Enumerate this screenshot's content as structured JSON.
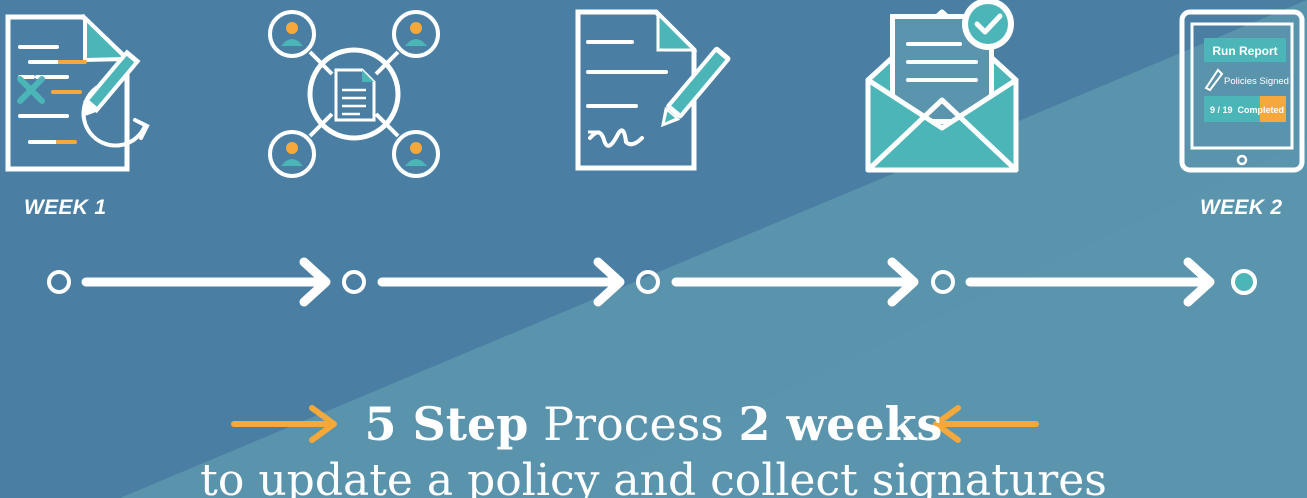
{
  "colors": {
    "background_dark": "#4a7fa3",
    "background_light": "#5b95ad",
    "teal": "#4bb5b8",
    "orange": "#f7a83a",
    "white": "#ffffff"
  },
  "labels": {
    "week_start": "WEEK 1",
    "week_end": "WEEK 2"
  },
  "steps": [
    {
      "icon": "edit-document-icon"
    },
    {
      "icon": "share-document-network-icon"
    },
    {
      "icon": "sign-document-icon"
    },
    {
      "icon": "envelope-check-icon"
    },
    {
      "icon": "tablet-report-icon"
    }
  ],
  "tablet": {
    "button": "Run Report",
    "status": "Policies Signed",
    "progress_text": "9 / 19  Completed",
    "progress_fraction": 0.47
  },
  "headline": {
    "part1": "5 Step",
    "part2": " Process ",
    "part3": "2 weeks"
  },
  "subline": "to update a policy and collect signatures"
}
